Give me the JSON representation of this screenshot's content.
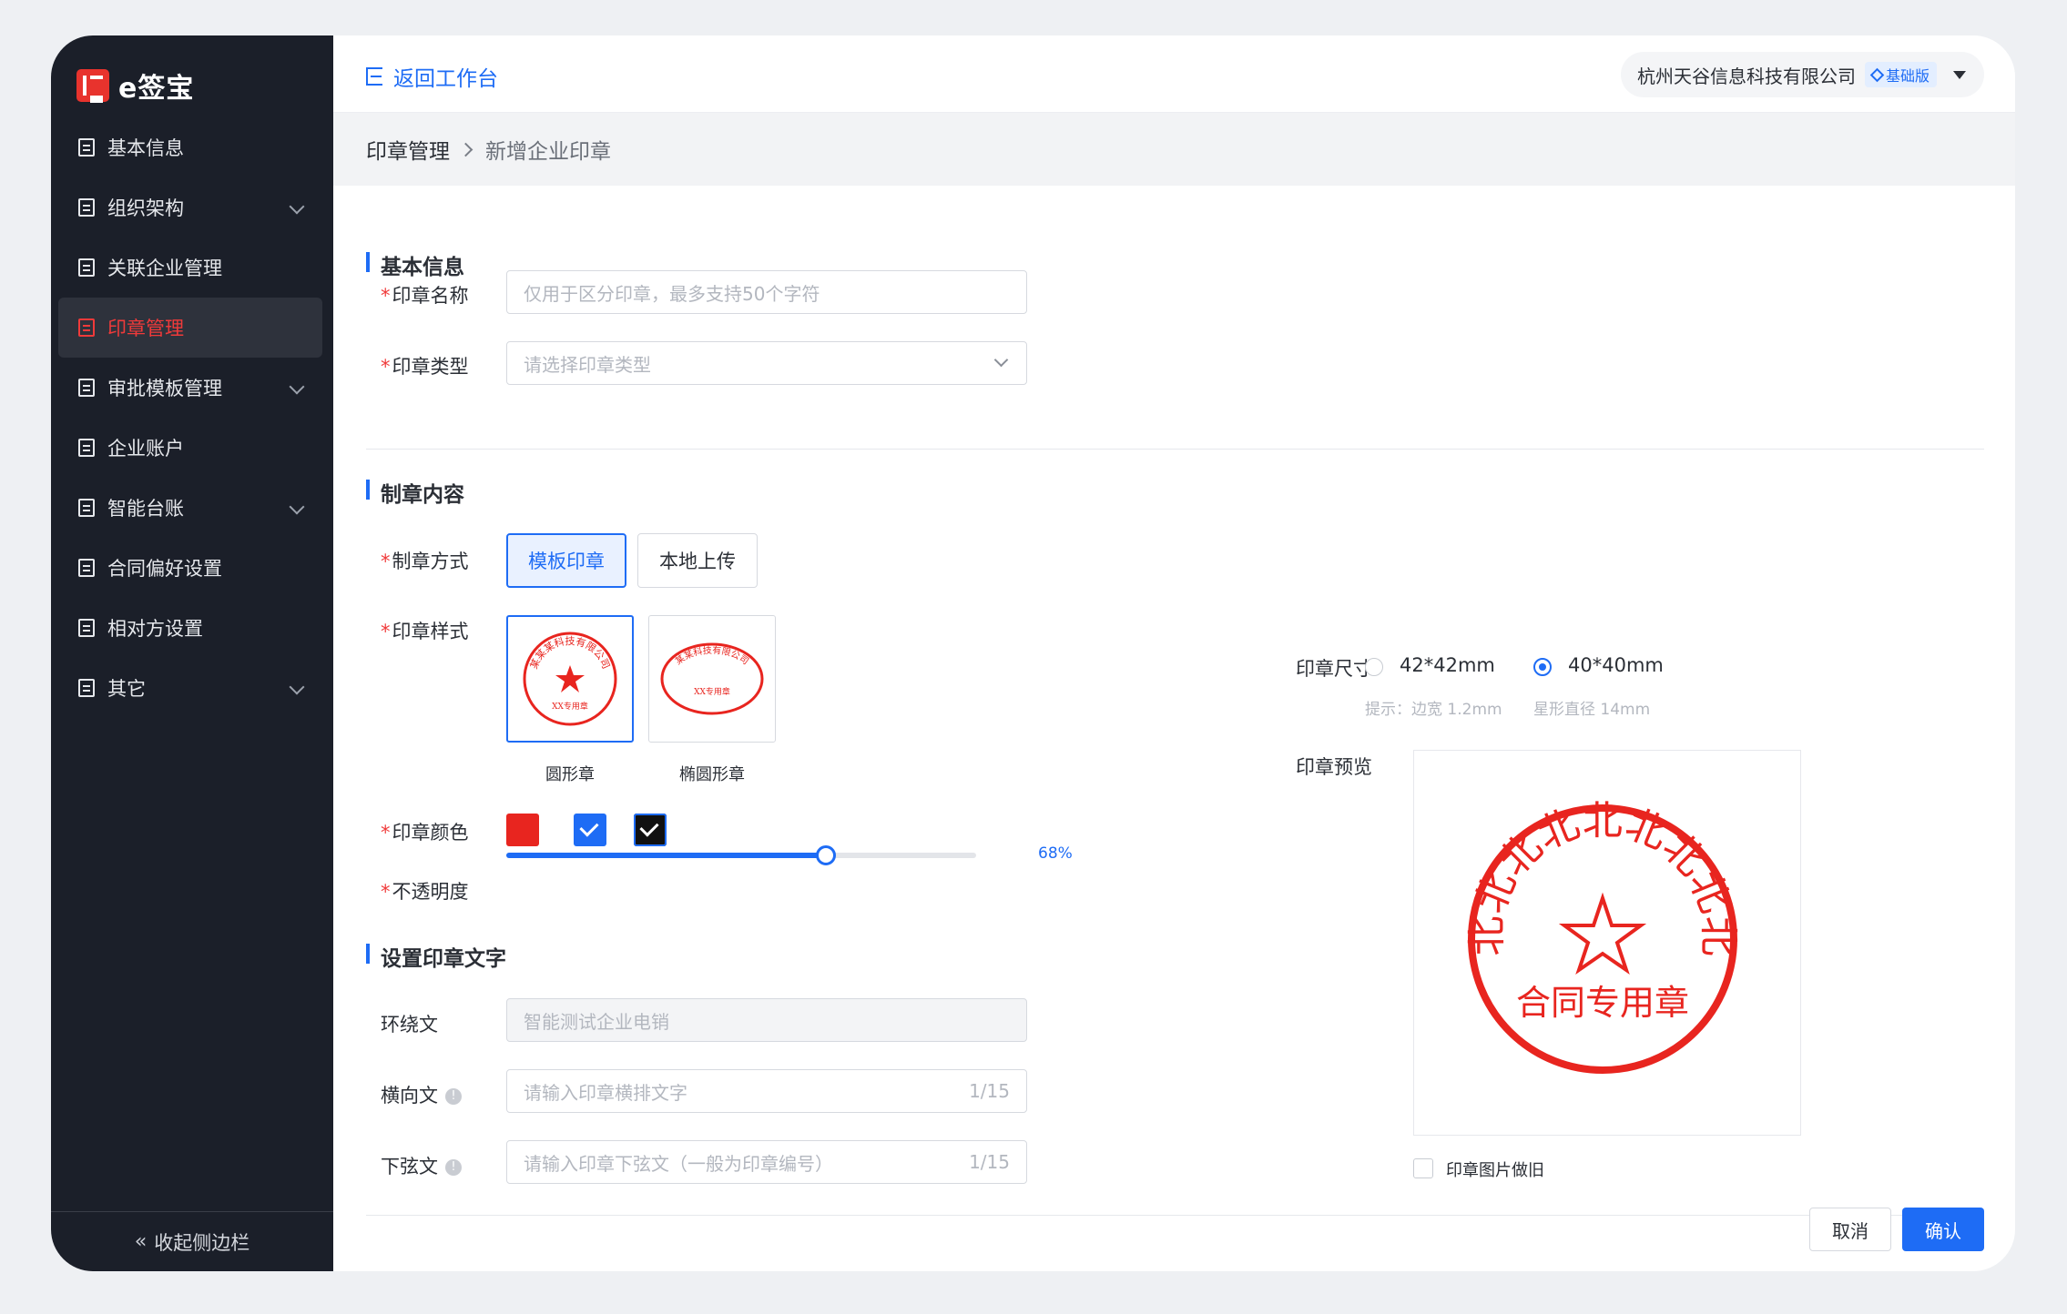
{
  "app": {
    "logo_text": "e签宝"
  },
  "sidebar": {
    "items": [
      {
        "label": "基本信息",
        "icon": "document-icon",
        "active": false,
        "expandable": false
      },
      {
        "label": "组织架构",
        "icon": "org-tree-icon",
        "active": false,
        "expandable": true
      },
      {
        "label": "关联企业管理",
        "icon": "link-company-icon",
        "active": false,
        "expandable": false
      },
      {
        "label": "印章管理",
        "icon": "seal-icon",
        "active": true,
        "expandable": false
      },
      {
        "label": "审批模板管理",
        "icon": "template-icon",
        "active": false,
        "expandable": true
      },
      {
        "label": "企业账户",
        "icon": "building-icon",
        "active": false,
        "expandable": false
      },
      {
        "label": "智能台账",
        "icon": "ledger-icon",
        "active": false,
        "expandable": true
      },
      {
        "label": "合同偏好设置",
        "icon": "contract-icon",
        "active": false,
        "expandable": false
      },
      {
        "label": "相对方设置",
        "icon": "counterparty-icon",
        "active": false,
        "expandable": false
      },
      {
        "label": "其它",
        "icon": "more-icon",
        "active": false,
        "expandable": true
      }
    ],
    "collapse_label": "收起侧边栏"
  },
  "header": {
    "back_label": "返回工作台",
    "company_name": "杭州天谷信息科技有限公司",
    "plan_badge": "基础版"
  },
  "breadcrumb": {
    "parent": "印章管理",
    "current": "新增企业印章"
  },
  "basic_info": {
    "title": "基本信息",
    "name_label": "印章名称",
    "name_placeholder": "仅用于区分印章，最多支持50个字符",
    "type_label": "印章类型",
    "type_placeholder": "请选择印章类型"
  },
  "content": {
    "title": "制章内容",
    "method_label": "制章方式",
    "method_options": [
      "模板印章",
      "本地上传"
    ],
    "method_selected": "模板印章",
    "style_label": "印章样式",
    "styles": [
      "圆形章",
      "椭圆形章"
    ],
    "style_selected": "圆形章",
    "color_label": "印章颜色",
    "colors": [
      "#e8251f",
      "#1e6cf5",
      "#111111"
    ],
    "opacity_label": "不透明度",
    "opacity_value": "68%",
    "opacity": 0.68
  },
  "seal_text": {
    "title": "设置印章文字",
    "surround_label": "环绕文",
    "surround_value": "智能测试企业电销",
    "horizontal_label": "横向文",
    "horizontal_placeholder": "请输入印章横排文字",
    "horizontal_count": "1/15",
    "bottom_label": "下弦文",
    "bottom_placeholder": "请输入印章下弦文（一般为印章编号）",
    "bottom_count": "1/15"
  },
  "size": {
    "label": "印章尺寸",
    "options": [
      "42*42mm",
      "40*40mm"
    ],
    "selected": "40*40mm",
    "hint_prefix": "提示：",
    "hint_border": "边宽 1.2mm",
    "hint_star": "星形直径 14mm"
  },
  "preview": {
    "label": "印章预览",
    "ring_text": "北北北北北北北北北",
    "center_text": "合同专用章",
    "seal_color": "#e8251f",
    "aged_label": "印章图片做旧"
  },
  "thumbnails": {
    "round_top": "某某某科技有限公司",
    "round_bottom": "XX专用章",
    "oval_top": "某某科技有限公司",
    "oval_bottom": "XX专用章"
  },
  "footer": {
    "cancel_label": "取消",
    "confirm_label": "确认"
  }
}
